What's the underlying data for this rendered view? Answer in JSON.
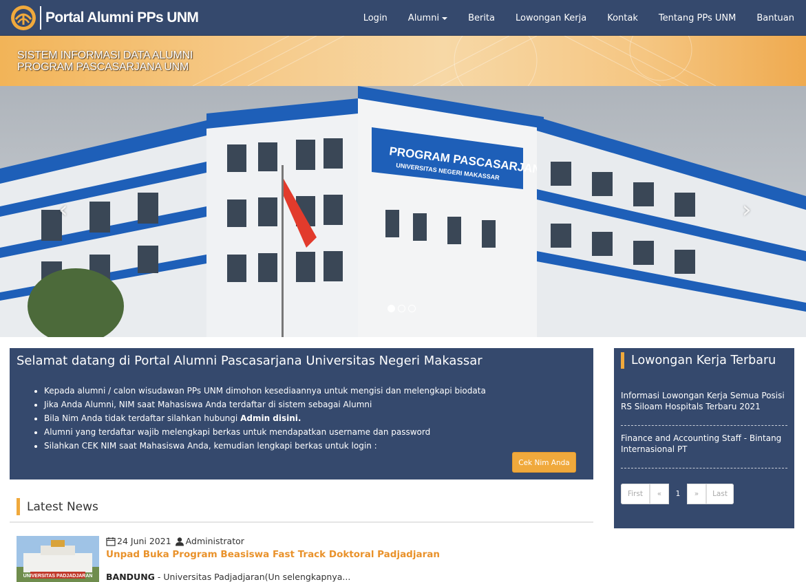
{
  "navbar": {
    "brand_text": "Portal Alumni PPs UNM",
    "items": [
      {
        "label": "Login"
      },
      {
        "label": "Alumni",
        "dropdown": true
      },
      {
        "label": "Berita"
      },
      {
        "label": "Lowongan Kerja"
      },
      {
        "label": "Kontak"
      },
      {
        "label": "Tentang PPs UNM"
      },
      {
        "label": "Bantuan"
      }
    ]
  },
  "banner": {
    "line1": "SISTEM INFORMASI DATA ALUMNI",
    "line2": "PROGRAM PASCASARJANA UNM"
  },
  "carousel": {
    "building_sign_line1": "PROGRAM PASCASARJANA",
    "building_sign_line2": "UNIVERSITAS NEGERI MAKASSAR",
    "prev_icon": "‹",
    "next_icon": "›",
    "slide_count": 3,
    "active_index": 0
  },
  "welcome": {
    "title": "Selamat datang di Portal Alumni Pascasarjana Universitas Negeri Makassar",
    "items": [
      "Kepada alumni / calon wisudawan PPs UNM dimohon kesediaannya untuk mengisi dan melengkapi biodata",
      "Jika Anda Alumni, NIM saat Mahasiswa Anda terdaftar di sistem sebagai Alumni",
      "Bila Nim Anda tidak terdaftar silahkan hubungi",
      "Alumni yang terdaftar wajib melengkapi berkas untuk mendapatkan username dan password",
      "Silahkan CEK NIM saat Mahasiswa Anda, kemudian lengkapi berkas untuk login :"
    ],
    "admin_link": "Admin disini.",
    "button_label": "Cek Nim Anda"
  },
  "news": {
    "heading": "Latest News",
    "date": "24 Juni 2021",
    "author": "Administrator",
    "title": "Unpad Buka Program Beasiswa Fast Track Doktoral Padjadjaran",
    "excerpt_city": "BANDUNG",
    "excerpt_text": " - Universitas Padjadjaran(Un selengkapnya...",
    "thumb_caption": "UNIVERSITAS PADJADJARAN"
  },
  "sidebar": {
    "title": "Lowongan Kerja Terbaru",
    "jobs": [
      "Informasi Lowongan Kerja Semua Posisi RS Siloam Hospitals Terbaru 2021",
      "Finance and Accounting Staff - Bintang Internasional PT"
    ],
    "pager": [
      "First",
      "«",
      "1",
      "»",
      "Last"
    ],
    "current_page": "1"
  },
  "colors": {
    "navy": "#35496d",
    "accent": "#f0a93c",
    "link": "#e9922b"
  }
}
